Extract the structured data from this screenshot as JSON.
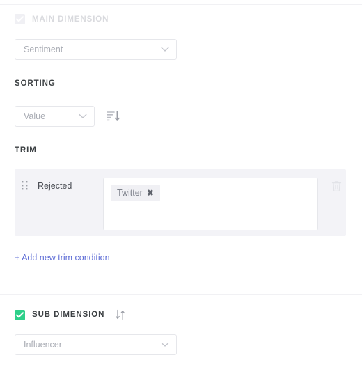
{
  "sections": {
    "main_dimension": {
      "label": "MAIN DIMENSION",
      "checkbox_state": "checked-disabled",
      "select": {
        "value": "Sentiment",
        "chevron_icon": "chevron-down-icon"
      }
    },
    "sorting": {
      "label": "SORTING",
      "select": {
        "value": "Value",
        "chevron_icon": "chevron-down-icon"
      },
      "sort_direction_icon": "sort-descending-icon"
    },
    "trim": {
      "label": "TRIM",
      "rows": [
        {
          "drag_handle_icon": "drag-handle-icon",
          "condition_label": "Rejected",
          "tags": [
            {
              "label": "Twitter",
              "remove_icon": "close-icon"
            }
          ],
          "delete_icon": "trash-icon"
        }
      ],
      "add_link": "+ Add new trim condition"
    },
    "sub_dimension": {
      "label": "SUB DIMENSION",
      "checkbox_state": "checked",
      "swap_icon": "swap-vertical-icon",
      "select": {
        "value": "Influencer",
        "chevron_icon": "chevron-down-icon"
      }
    }
  },
  "colors": {
    "accent_green": "#2ed08a",
    "link_blue": "#5e6dd6",
    "panel_bg": "#f3f3f7",
    "chip_bg": "#f0f0f4",
    "label_dark": "#3c4043",
    "label_disabled": "#d9dade",
    "placeholder": "#a9acb4",
    "border": "#e6e7eb"
  }
}
